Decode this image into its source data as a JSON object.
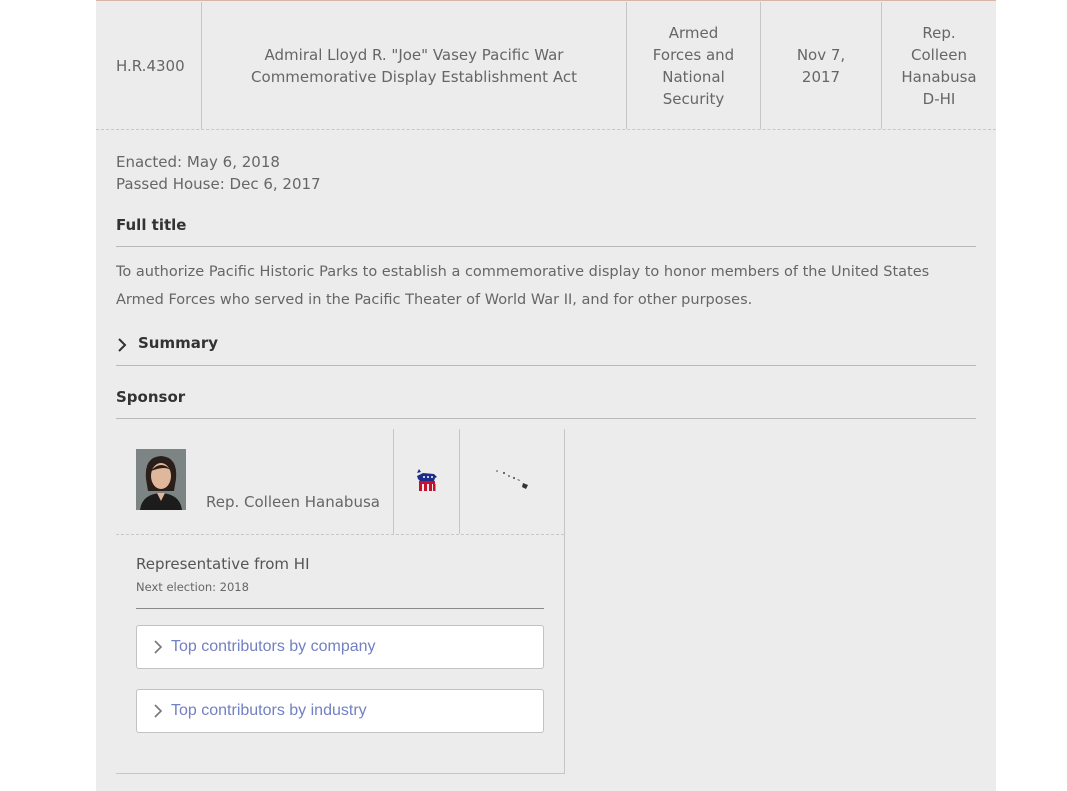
{
  "bill": {
    "number": "H.R.4300",
    "title": "Admiral Lloyd R. \"Joe\" Vasey Pacific War Commemorative Display Establishment Act",
    "category": "Armed Forces and National Security",
    "date": "Nov 7, 2017",
    "sponsor": "Rep. Colleen Hanabusa D-HI"
  },
  "status": {
    "enacted": "Enacted: May 6, 2018",
    "passed_house": "Passed House: Dec 6, 2017"
  },
  "full_title": {
    "heading": "Full title",
    "text": "To authorize Pacific Historic Parks to establish a commemorative display to honor members of the United States Armed Forces who served in the Pacific Theater of World War II, and for other purposes."
  },
  "summary": {
    "label": "Summary",
    "icon": "chevron-right-icon"
  },
  "sponsor": {
    "heading": "Sponsor",
    "name": "Rep. Colleen Hanabusa",
    "party_icon": "democrat-donkey-icon",
    "state_icon": "hawaii-map-icon",
    "role": "Representative from HI",
    "next_election": "Next election: 2018",
    "buttons": {
      "by_company": "Top contributors by company",
      "by_industry": "Top contributors by industry"
    }
  },
  "colors": {
    "panel_bg": "#ececec",
    "link": "#7280c4",
    "text": "#666666"
  }
}
